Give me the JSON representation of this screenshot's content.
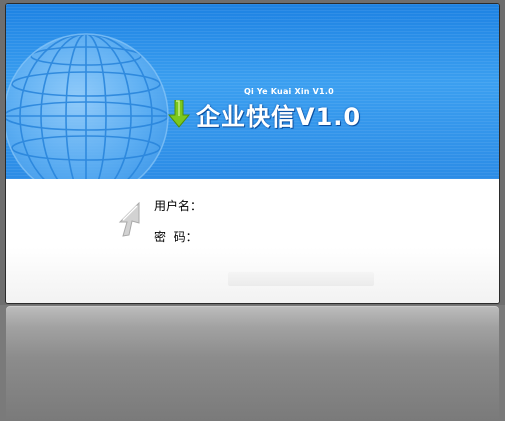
{
  "banner": {
    "tagline": "Qi Ye Kuai Xin V1.0",
    "title": "企业快信V1.0",
    "icons": {
      "globe": "globe-icon",
      "arrow": "download-arrow-icon"
    },
    "colors": {
      "banner_top": "#1d82e3",
      "banner_mid": "#3b9ff0",
      "arrow_green": "#7cc81e"
    }
  },
  "form": {
    "username_label": "用户名：",
    "password_label": "密  码：",
    "username_value": "",
    "password_value": "",
    "icons": {
      "cursor": "cursor-arrow-icon"
    }
  }
}
